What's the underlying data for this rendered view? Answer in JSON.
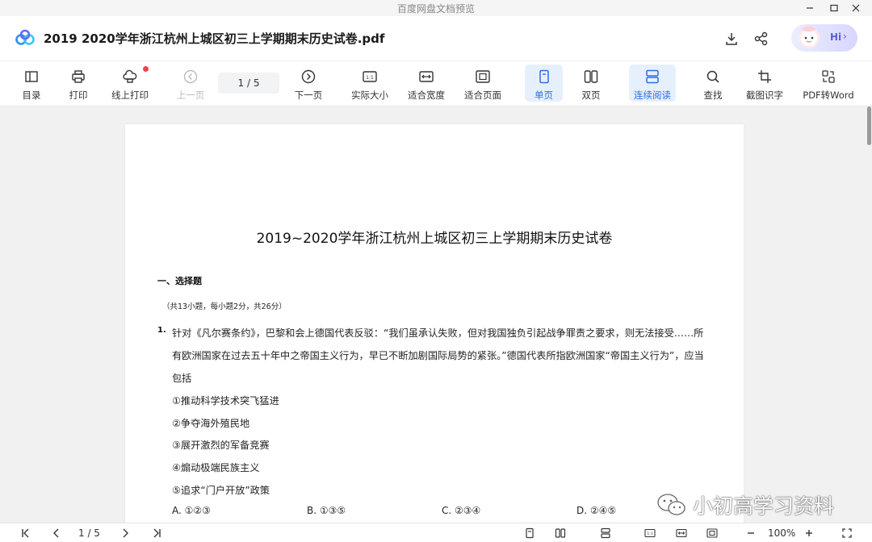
{
  "window": {
    "title": "百度网盘文档预览"
  },
  "doc": {
    "title": "2019  2020学年浙江杭州上城区初三上学期期末历史试卷.pdf",
    "assistant_label": "Hi"
  },
  "toolbar": {
    "toc": "目录",
    "print": "打印",
    "online_print": "线上打印",
    "prev": "上一页",
    "page_indicator": "1 / 5",
    "next": "下一页",
    "actual_size": "实际大小",
    "fit_width": "适合宽度",
    "fit_page": "适合页面",
    "single_page": "单页",
    "double_page": "双页",
    "continuous": "连续阅读",
    "find": "查找",
    "ocr": "截图识字",
    "pdf_to_word": "PDF转Word"
  },
  "page": {
    "paper_title": "2019~2020学年浙江杭州上城区初三上学期期末历史试卷",
    "section_title": "一、选择题",
    "section_note": "（共13小题，每小题2分，共26分）",
    "question_number": "1.",
    "question_lines": [
      "针对《凡尔赛条约》，巴黎和会上德国代表反驳：“我们虽承认失败，但对我国独负引起战争罪责之要求，则无法接受……所",
      "有欧洲国家在过去五十年中之帝国主义行为，早已不断加剧国际局势的紧张。”德国代表所指欧洲国家“帝国主义行为”，应当",
      "包括",
      "①推动科学技术突飞猛进",
      "②争夺海外殖民地",
      "③展开激烈的军备竞赛",
      "④煽动极端民族主义",
      "⑤追求“门户开放”政策"
    ],
    "options": [
      "A. ①②③",
      "B. ①③⑤",
      "C. ②③④",
      "D. ②④⑤"
    ]
  },
  "watermark": {
    "text": "小初高学习资料"
  },
  "statusbar": {
    "page_indicator": "1 / 5",
    "zoom": "100%"
  }
}
